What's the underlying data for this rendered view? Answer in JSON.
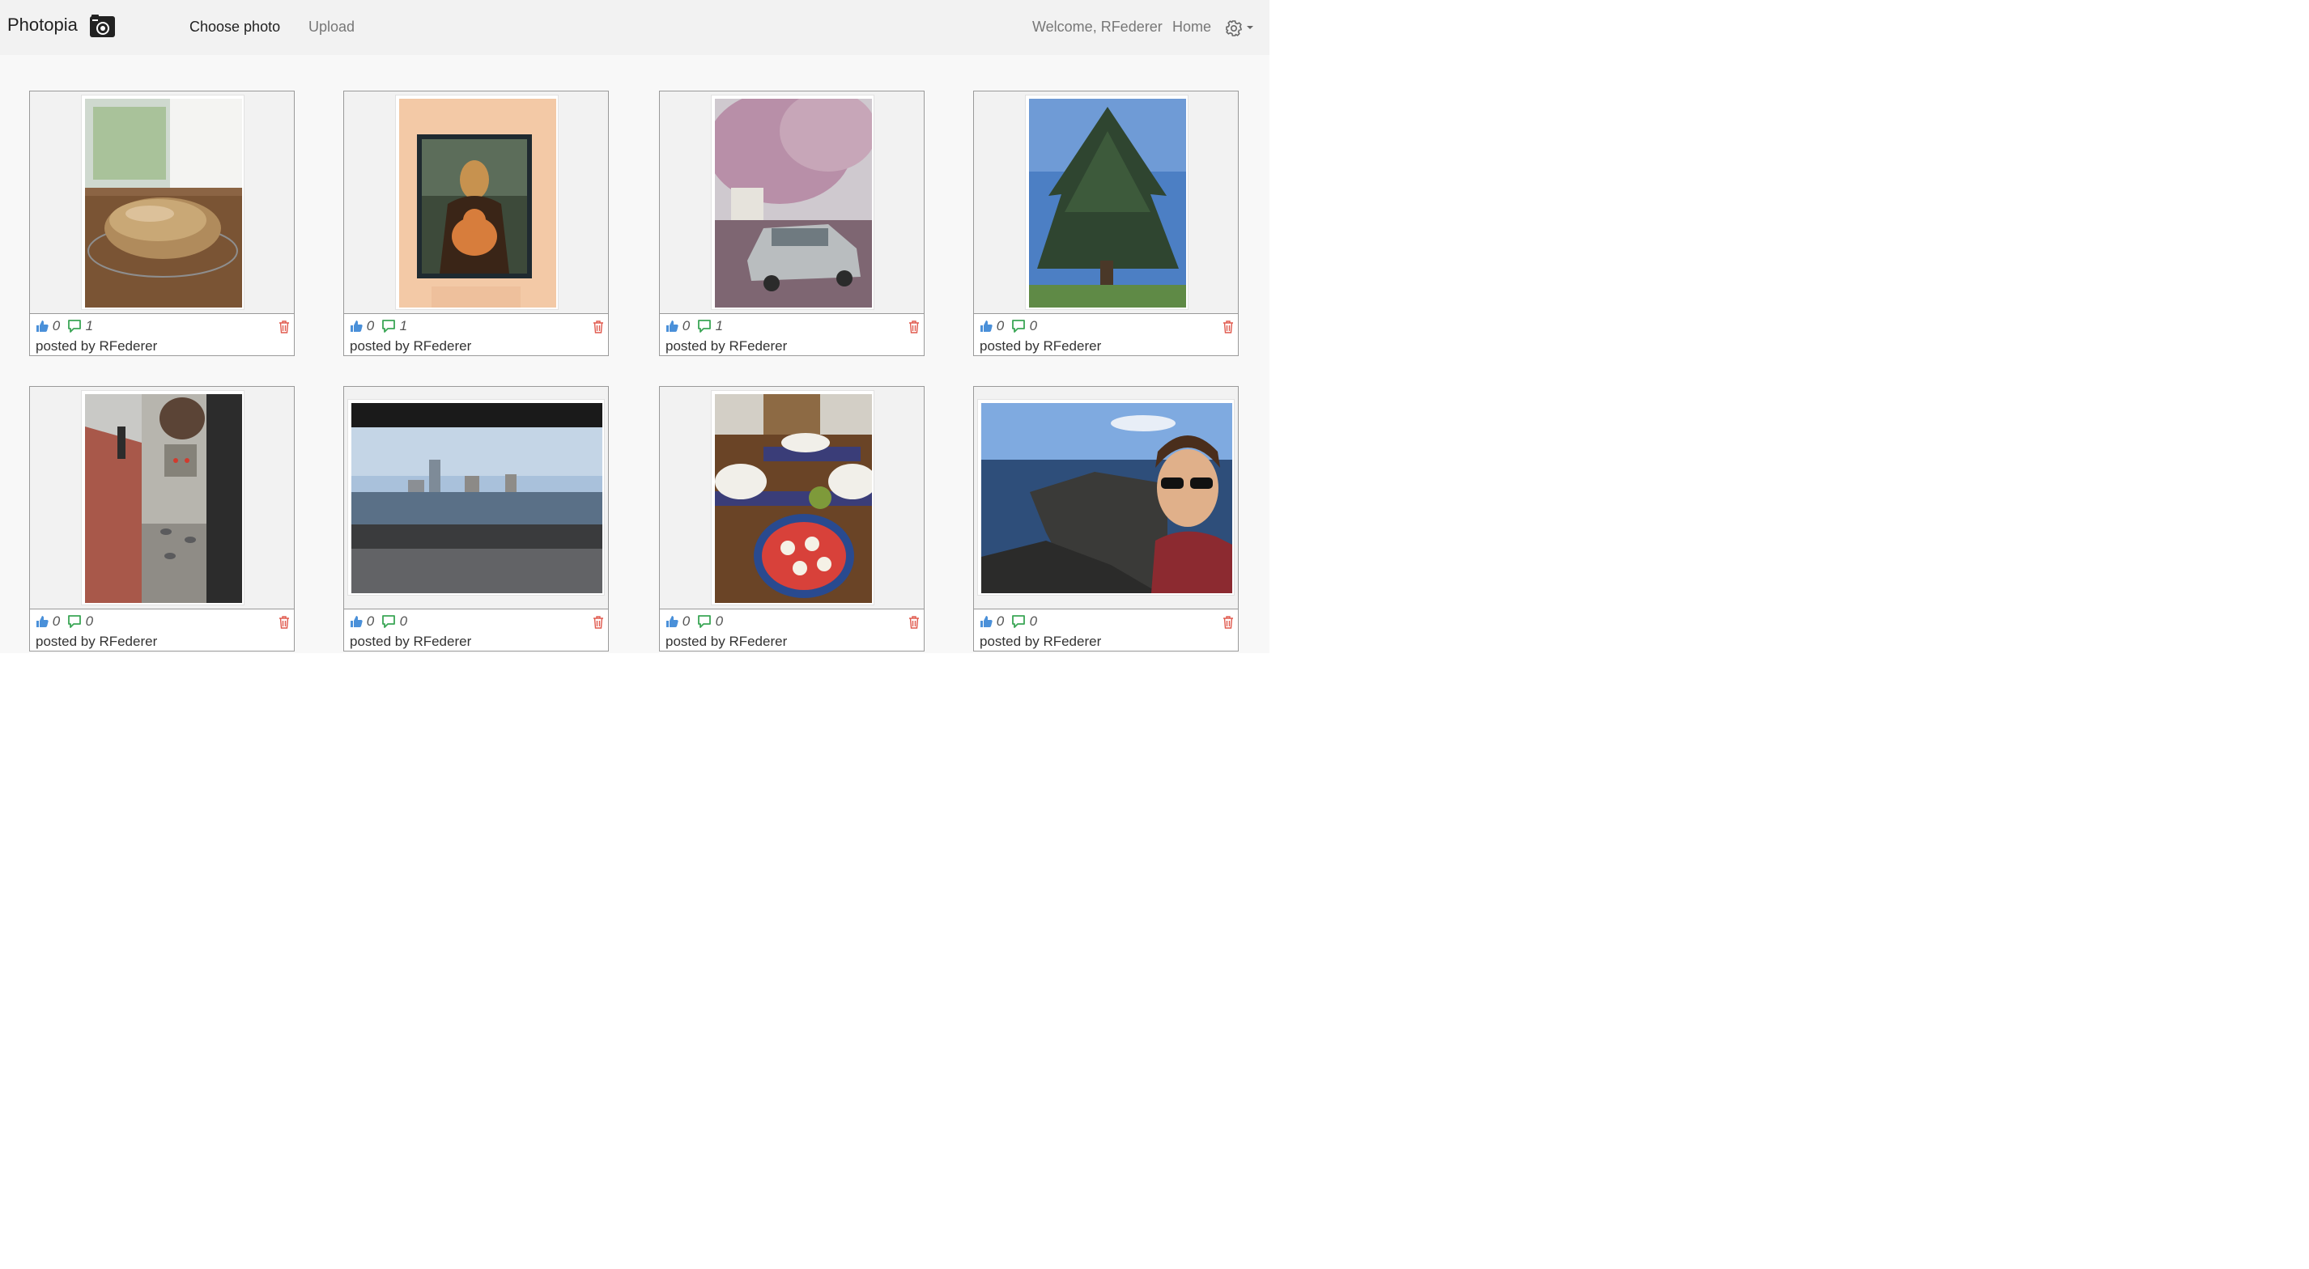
{
  "app": {
    "brand": "Photopia",
    "brand_icon": "camera-icon"
  },
  "nav": {
    "choose_photo": "Choose photo",
    "upload": "Upload",
    "welcome": "Welcome, RFederer",
    "home": "Home",
    "settings_icon": "gear-icon"
  },
  "colors": {
    "like": "#4a90d9",
    "comment": "#3aa655",
    "delete": "#e05a4e"
  },
  "posts": [
    {
      "likes": "0",
      "comments": "1",
      "posted_by": "posted by RFederer",
      "subject": "bread loaf on cooling rack"
    },
    {
      "likes": "0",
      "comments": "1",
      "posted_by": "posted by RFederer",
      "subject": "mona lisa with cat painting"
    },
    {
      "likes": "0",
      "comments": "1",
      "posted_by": "posted by RFederer",
      "subject": "silver car under blossoming tree"
    },
    {
      "likes": "0",
      "comments": "0",
      "posted_by": "posted by RFederer",
      "subject": "tall evergreen tree"
    },
    {
      "likes": "0",
      "comments": "0",
      "posted_by": "posted by RFederer",
      "subject": "pigeons on sidewalk"
    },
    {
      "likes": "0",
      "comments": "0",
      "posted_by": "posted by RFederer",
      "subject": "city skyline over river"
    },
    {
      "likes": "0",
      "comments": "0",
      "posted_by": "posted by RFederer",
      "subject": "dinner table with caprese"
    },
    {
      "likes": "0",
      "comments": "0",
      "posted_by": "posted by RFederer",
      "subject": "selfie at rocky coastline"
    }
  ]
}
